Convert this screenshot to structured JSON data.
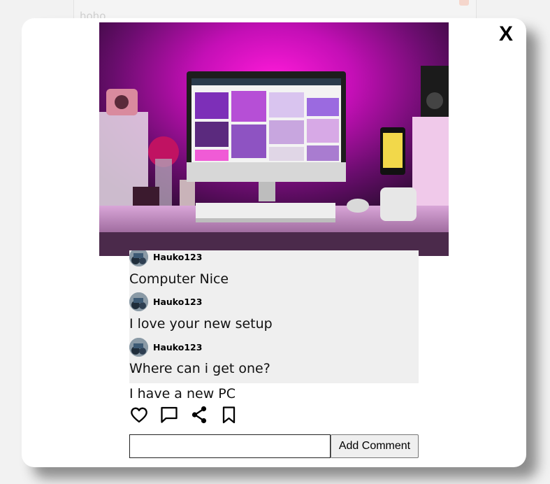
{
  "background": {
    "text": "hoho"
  },
  "modal": {
    "close_label": "X",
    "photo_icon": "desk-setup-photo",
    "comments": [
      {
        "user": "Hauko123",
        "text": "Computer Nice"
      },
      {
        "user": "Hauko123",
        "text": "I love your new setup"
      },
      {
        "user": "Hauko123",
        "text": "Where can i get one?"
      }
    ],
    "caption": "I have a new PC",
    "actions": [
      {
        "icon": "heart-icon"
      },
      {
        "icon": "comment-icon"
      },
      {
        "icon": "share-icon"
      },
      {
        "icon": "bookmark-icon"
      }
    ],
    "comment_input": {
      "value": "",
      "placeholder": ""
    },
    "add_comment_label": "Add Comment"
  },
  "colors": {
    "modal_bg": "#ffffff",
    "comments_bg": "#efefef",
    "photo_glow": "#ff00cc"
  }
}
